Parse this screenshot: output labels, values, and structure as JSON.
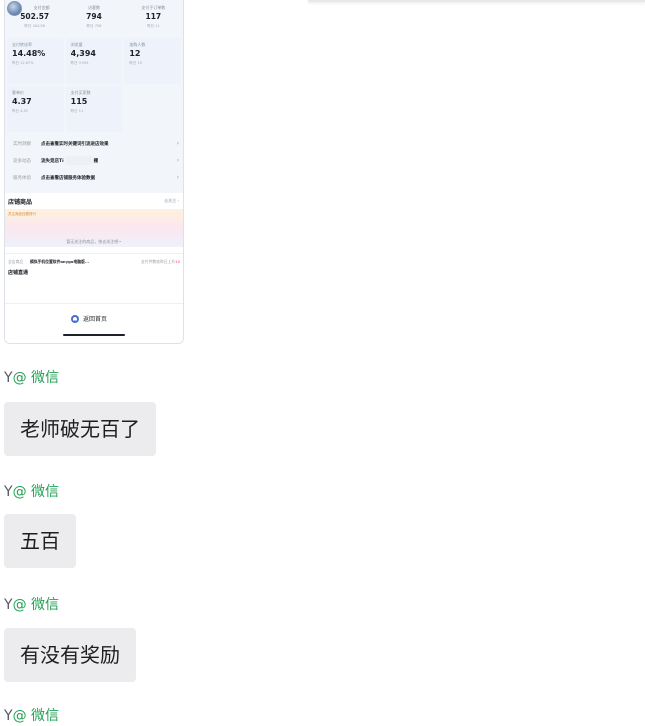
{
  "screenshot": {
    "stats_row1": [
      {
        "label": "支付金额",
        "value": "502.57",
        "sub": "昨日 404.58"
      },
      {
        "label": "访客数",
        "value": "794",
        "sub": "昨日 726"
      },
      {
        "label": "支付子订单数",
        "value": "117",
        "sub": "昨日 11"
      }
    ],
    "stats_row2": [
      {
        "label": "支付转化率",
        "value": "14.48%",
        "sub": "昨日 12.67%"
      },
      {
        "label": "浏览量",
        "value": "4,394",
        "sub": "昨日 3,991"
      },
      {
        "label": "加购人数",
        "value": "12",
        "sub": "昨日 15"
      }
    ],
    "stats_row3": [
      {
        "label": "客单价",
        "value": "4.37",
        "sub": "昨日 4.45"
      },
      {
        "label": "支付买家数",
        "value": "115",
        "sub": "昨日 11"
      }
    ],
    "info_rows": [
      {
        "key": "实时洞察",
        "text": "点击查看实时关键词引流进店效果"
      },
      {
        "key": "竞争动态",
        "text": "流失竞店Ti",
        "text2": "棚"
      },
      {
        "key": "服务体验",
        "text": "点击查看店铺服务体验数据"
      }
    ],
    "shop": {
      "title": "店铺商品",
      "more": "去关注 ›",
      "banner_tag": "关注商品还看排行",
      "empty_text": "暂无关注的商品，快去关注吧~",
      "product_key": "全店商品",
      "product_text": "模拟手机位置软件anygo电脑版...",
      "product_extra_prefix": "支付件数较昨日上升",
      "product_extra_num": "10",
      "next_title": "店铺直通"
    },
    "home_label": "返回首页"
  },
  "messages": [
    {
      "sender": "Y",
      "source": "@ 微信",
      "text": "老师破无百了"
    },
    {
      "sender": "Y",
      "source": "@ 微信",
      "text": "五百"
    },
    {
      "sender": "Y",
      "source": "@ 微信",
      "text": "有没有奖励"
    },
    {
      "sender": "Y",
      "source": "@ 微信"
    }
  ],
  "colors": {
    "source_green": "#21a153",
    "bubble": "#ececee"
  }
}
